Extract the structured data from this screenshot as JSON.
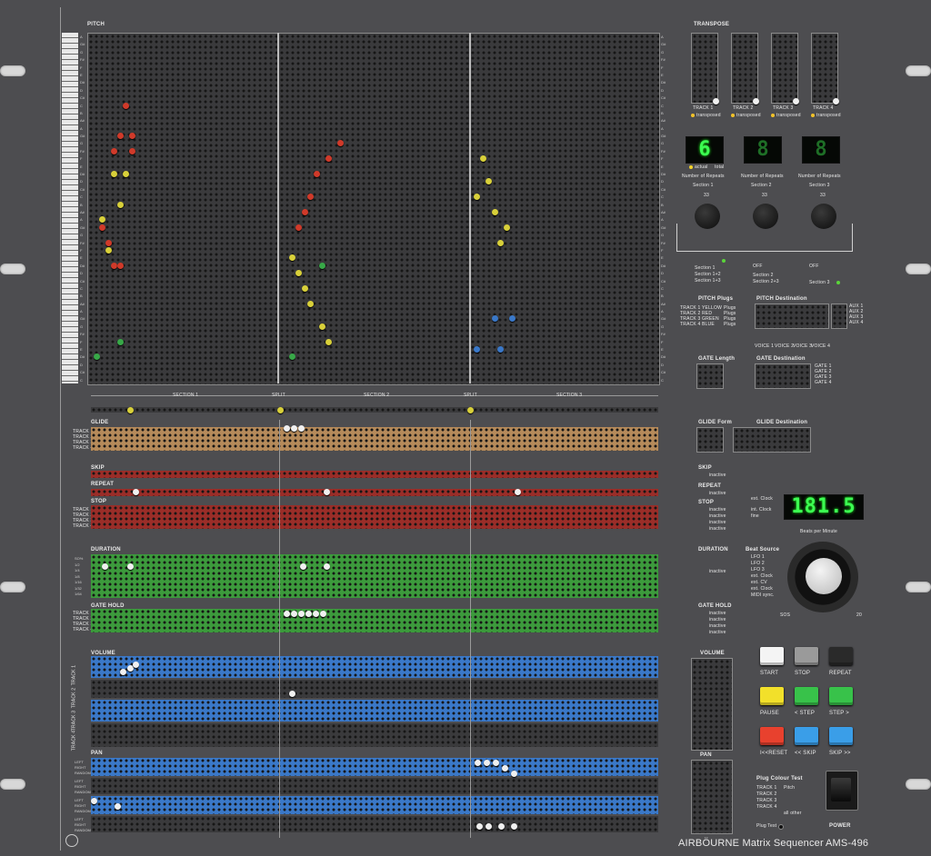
{
  "colors": {
    "panel": "#4d4d50",
    "grid": "#8a8a8a",
    "glide": "#b58a5a",
    "skip": "#9a2d28",
    "duration": "#3c9a3c",
    "volume": "#3a78c8",
    "lcd": "#3cff52"
  },
  "pitch": {
    "label": "PITCH",
    "note_names": [
      "A",
      "G#",
      "G",
      "F#",
      "F",
      "E",
      "D#",
      "D",
      "C#",
      "C",
      "B",
      "A#",
      "A",
      "G#",
      "G",
      "F#",
      "F",
      "E",
      "D#",
      "D",
      "C#",
      "C",
      "B",
      "A#",
      "A",
      "G#",
      "G",
      "F#",
      "F",
      "E",
      "D#",
      "D",
      "C#",
      "C",
      "B",
      "A#",
      "A",
      "G#",
      "G",
      "F#",
      "F",
      "E",
      "D#",
      "D",
      "C#",
      "C"
    ]
  },
  "sections": {
    "labels": [
      "SECTION 1",
      "SPLIT",
      "SECTION 2",
      "SPLIT",
      "SECTION 3"
    ]
  },
  "rows": {
    "glide": {
      "label": "GLIDE",
      "tracks": [
        "TRACK 1",
        "TRACK 2",
        "TRACK 3",
        "TRACK 4"
      ]
    },
    "skip": {
      "label": "SKIP"
    },
    "repeat": {
      "label": "REPEAT"
    },
    "stop": {
      "label": "STOP",
      "tracks": [
        "TRACK 1",
        "TRACK 2",
        "TRACK 3",
        "TRACK 4"
      ]
    },
    "duration": {
      "label": "DURATION",
      "values": [
        "SO%",
        "1/2",
        "1/4",
        "1/8",
        "1/16",
        "1/32",
        "1/64"
      ]
    },
    "gate_hold": {
      "label": "GATE HOLD",
      "tracks": [
        "TRACK 1",
        "TRACK 2",
        "TRACK 3",
        "TRACK 4"
      ]
    },
    "volume": {
      "label": "VOLUME",
      "tracks": [
        "TRACK 1",
        "TRACK 2",
        "TRACK 3",
        "TRACK 4"
      ]
    },
    "pan": {
      "label": "PAN",
      "options": [
        "LEFT",
        "RIGHT",
        "RANDOM"
      ]
    }
  },
  "transpose": {
    "label": "TRANSPOSE",
    "scale": [
      "-2",
      "-1",
      "0",
      "+1"
    ],
    "tracks": [
      "TRACK 1",
      "TRACK 2",
      "TRACK 3",
      "TRACK 4"
    ],
    "status": "transposed"
  },
  "repeats": {
    "digits": [
      "6",
      "8",
      "8"
    ],
    "caption": "Number of Repeats",
    "actual": "actual",
    "total": "total",
    "sections": [
      "Section 1",
      "Section 2",
      "Section 3"
    ],
    "knob_marks": [
      "33",
      "33",
      "33"
    ]
  },
  "section_mode": {
    "options": [
      "Section 1",
      "Section 1+2",
      "Section 1+3",
      "Section 2",
      "Section 2+3",
      "Section 3"
    ],
    "off": "OFF"
  },
  "pitch_plugs": {
    "label": "PITCH Plugs",
    "rows": [
      "TRACK 1",
      "TRACK 2",
      "TRACK 3",
      "TRACK 4"
    ],
    "colors": [
      "YELLOW",
      "RED",
      "GREEN",
      "BLUE"
    ],
    "plugs": "Plugs"
  },
  "pitch_dest": {
    "label": "PITCH Destination",
    "aux": [
      "AUX 1",
      "AUX 2",
      "AUX 3",
      "AUX 4"
    ],
    "voices": [
      "VOICE 1",
      "VOICE 2",
      "VOICE 3",
      "VOICE 4"
    ]
  },
  "gate_length": {
    "label": "GATE Length"
  },
  "gate_dest": {
    "label": "GATE Destination",
    "gates": [
      "GATE 1",
      "GATE 2",
      "GATE 3",
      "GATE 4"
    ]
  },
  "glide_form": {
    "label": "GLIDE Form"
  },
  "glide_dest": {
    "label": "GLIDE Destination"
  },
  "status": {
    "inactive": "inactive"
  },
  "clock": {
    "bpm": "181.5",
    "caption": "Beats per Minute",
    "ext": "ext. Clock",
    "int": "int. Clock",
    "fine": "fine"
  },
  "beat_source": {
    "label": "Beat Source",
    "options": [
      "LFO 1",
      "LFO 2",
      "LFO 3",
      "ext. Clock",
      "ext. CV",
      "ext. Clock",
      "MIDI sync."
    ],
    "min": "SOS",
    "max": "20"
  },
  "transport": {
    "labels": [
      "START",
      "STOP",
      "REPEAT",
      "PAUSE",
      "< STEP",
      "STEP >",
      "I<<RESET",
      "<< SKIP",
      "SKIP >>"
    ],
    "colors": [
      "#f4f4f4",
      "#9a9a9a",
      "#2a2a2a",
      "#f2e02a",
      "#38c24a",
      "#38c24a",
      "#e8412e",
      "#3a9ee8",
      "#3a9ee8"
    ]
  },
  "volume_panel": {
    "label": "VOLUME"
  },
  "pan_panel": {
    "label": "PAN"
  },
  "plug_test": {
    "label": "Plug Colour Test",
    "rows": [
      "TRACK 1",
      "TRACK 2",
      "TRACK 3",
      "TRACK 4"
    ],
    "pitch": "Pitch",
    "all_other": "all other",
    "plug_test": "Plug Test"
  },
  "power": {
    "label": "POWER"
  },
  "brand": {
    "name": "AIRBÖURNE Matrix Sequencer",
    "model": "AMS-496"
  },
  "pitch_pegs": [
    {
      "color": "#d8d03a",
      "x": 4,
      "y": 18
    },
    {
      "color": "#d8d03a",
      "x": 5,
      "y": 22
    },
    {
      "color": "#d8d03a",
      "x": 6,
      "y": 18
    },
    {
      "color": "#d03a2a",
      "x": 6,
      "y": 9
    },
    {
      "color": "#d03a2a",
      "x": 5,
      "y": 13
    },
    {
      "color": "#d03a2a",
      "x": 7,
      "y": 13
    },
    {
      "color": "#d03a2a",
      "x": 4,
      "y": 15
    },
    {
      "color": "#d03a2a",
      "x": 7,
      "y": 15
    },
    {
      "color": "#d03a2a",
      "x": 2,
      "y": 25
    },
    {
      "color": "#d03a2a",
      "x": 3,
      "y": 27
    },
    {
      "color": "#d03a2a",
      "x": 4,
      "y": 30
    },
    {
      "color": "#d03a2a",
      "x": 5,
      "y": 30
    },
    {
      "color": "#d8d03a",
      "x": 2,
      "y": 24
    },
    {
      "color": "#d8d03a",
      "x": 3,
      "y": 28
    },
    {
      "color": "#38a848",
      "x": 5,
      "y": 40
    },
    {
      "color": "#38a848",
      "x": 1,
      "y": 42
    },
    {
      "color": "#d03a2a",
      "x": 42,
      "y": 14
    },
    {
      "color": "#d03a2a",
      "x": 40,
      "y": 16
    },
    {
      "color": "#d03a2a",
      "x": 38,
      "y": 18
    },
    {
      "color": "#d03a2a",
      "x": 37,
      "y": 21
    },
    {
      "color": "#d03a2a",
      "x": 36,
      "y": 23
    },
    {
      "color": "#d03a2a",
      "x": 35,
      "y": 25
    },
    {
      "color": "#d8d03a",
      "x": 34,
      "y": 29
    },
    {
      "color": "#d8d03a",
      "x": 35,
      "y": 31
    },
    {
      "color": "#d8d03a",
      "x": 36,
      "y": 33
    },
    {
      "color": "#d8d03a",
      "x": 37,
      "y": 35
    },
    {
      "color": "#d8d03a",
      "x": 39,
      "y": 38
    },
    {
      "color": "#d8d03a",
      "x": 40,
      "y": 40
    },
    {
      "color": "#38a848",
      "x": 39,
      "y": 30
    },
    {
      "color": "#38a848",
      "x": 34,
      "y": 42
    },
    {
      "color": "#d8d03a",
      "x": 66,
      "y": 16
    },
    {
      "color": "#d8d03a",
      "x": 67,
      "y": 19
    },
    {
      "color": "#d8d03a",
      "x": 65,
      "y": 21
    },
    {
      "color": "#d8d03a",
      "x": 68,
      "y": 23
    },
    {
      "color": "#d8d03a",
      "x": 70,
      "y": 25
    },
    {
      "color": "#d8d03a",
      "x": 69,
      "y": 27
    },
    {
      "color": "#3a78c8",
      "x": 68,
      "y": 37
    },
    {
      "color": "#3a78c8",
      "x": 71,
      "y": 37
    },
    {
      "color": "#3a78c8",
      "x": 65,
      "y": 41
    },
    {
      "color": "#3a78c8",
      "x": 69,
      "y": 41
    }
  ]
}
